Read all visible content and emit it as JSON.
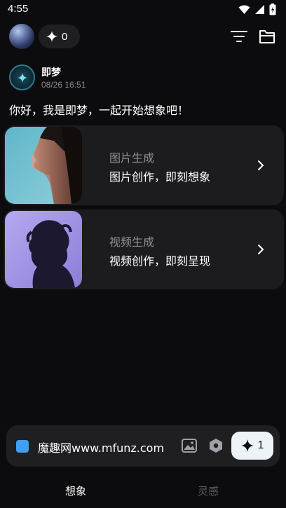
{
  "status_bar": {
    "time": "4:55",
    "icons": [
      "wifi-icon",
      "signal-icon",
      "battery-icon"
    ]
  },
  "top_bar": {
    "credits": "0",
    "icons": [
      "avatar-orb",
      "sparkle-icon",
      "filter-icon",
      "folder-icon"
    ]
  },
  "bot": {
    "name": "即梦",
    "timestamp": "08/26 16:51",
    "greeting": "你好，我是即梦，一起开始想象吧！"
  },
  "cards": [
    {
      "title": "图片生成",
      "description": "图片创作，即刻想象",
      "icon": "chevron-right-icon"
    },
    {
      "title": "视频生成",
      "description": "视频创作，即刻呈现",
      "icon": "chevron-right-icon"
    }
  ],
  "input_bar": {
    "text": "魔趣网www.mfunz.com",
    "generate_count": "1",
    "icons": [
      "image-icon",
      "hexagon-icon",
      "sparkle-icon"
    ]
  },
  "bottom_nav": {
    "tabs": [
      {
        "label": "想象",
        "active": true
      },
      {
        "label": "灵感",
        "active": false
      }
    ]
  },
  "colors": {
    "background": "#0c0c0e",
    "card": "#1c1c1f",
    "accent_blue": "#3da0f2",
    "generate_button": "#eef3f8"
  }
}
